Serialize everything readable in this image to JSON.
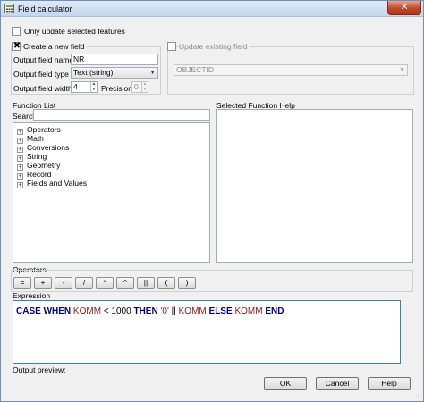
{
  "window": {
    "title": "Field calculator",
    "close": "✕"
  },
  "options": {
    "only_selected": "Only update selected features",
    "create_new": "Create a new field",
    "create_mark": "✖",
    "update_existing": "Update existing field"
  },
  "new_field": {
    "name_label": "Output field name",
    "name_value": "NR",
    "type_label": "Output field type",
    "type_value": "Text (string)",
    "width_label": "Output field width",
    "width_value": "4",
    "precision_label": "Precision",
    "precision_value": "0"
  },
  "existing_field": {
    "selected": "OBJECTID"
  },
  "function_list": {
    "title": "Function List",
    "search_label": "Search",
    "items": [
      "Operators",
      "Math",
      "Conversions",
      "String",
      "Geometry",
      "Record",
      "Fields and Values"
    ]
  },
  "help": {
    "title": "Selected Function Help"
  },
  "operators": {
    "title": "Operators",
    "buttons": [
      "=",
      "+",
      "-",
      "/",
      "*",
      "^",
      "||",
      "(",
      ")"
    ]
  },
  "expression": {
    "title": "Expression",
    "tokens": [
      "CASE",
      "WHEN",
      "KOMM",
      "< 1000",
      "THEN",
      "'0'",
      "||",
      "KOMM",
      "ELSE",
      "KOMM",
      "END"
    ]
  },
  "preview": {
    "label": "Output preview:"
  },
  "buttons": {
    "ok": "OK",
    "cancel": "Cancel",
    "help": "Help"
  }
}
